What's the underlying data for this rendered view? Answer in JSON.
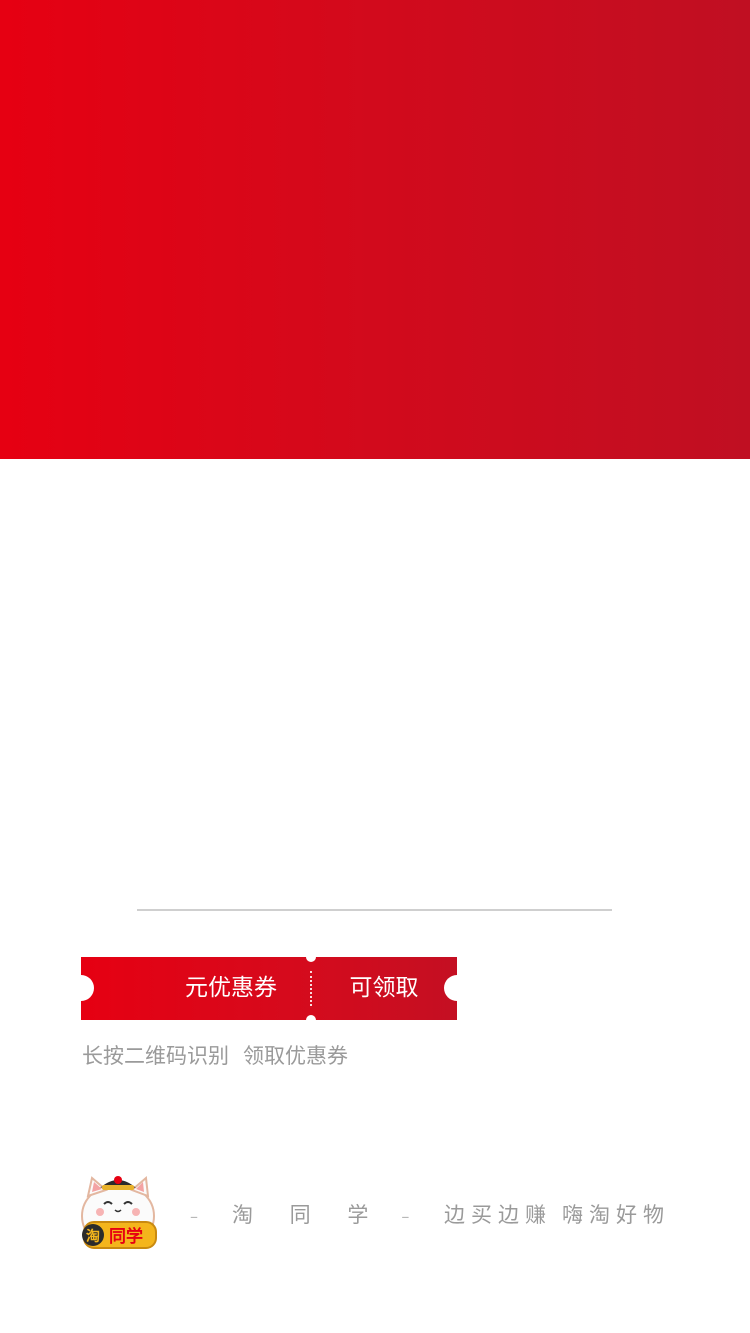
{
  "coupon": {
    "amount_label": "元优惠券",
    "cta_label": "可领取"
  },
  "hint": {
    "part1": "长按二维码识别",
    "part2": "领取优惠券"
  },
  "footer": {
    "logo_text": "淘同学",
    "brand_name": "淘 同 学",
    "dash": "–",
    "slogan_part1": "边买边赚",
    "slogan_part2": "嗨淘好物"
  },
  "colors": {
    "brand_red": "#e60012",
    "brand_red_dark": "#c00f22",
    "hint_gray": "#9a9a9a",
    "divider_gray": "#cfcfcf"
  }
}
